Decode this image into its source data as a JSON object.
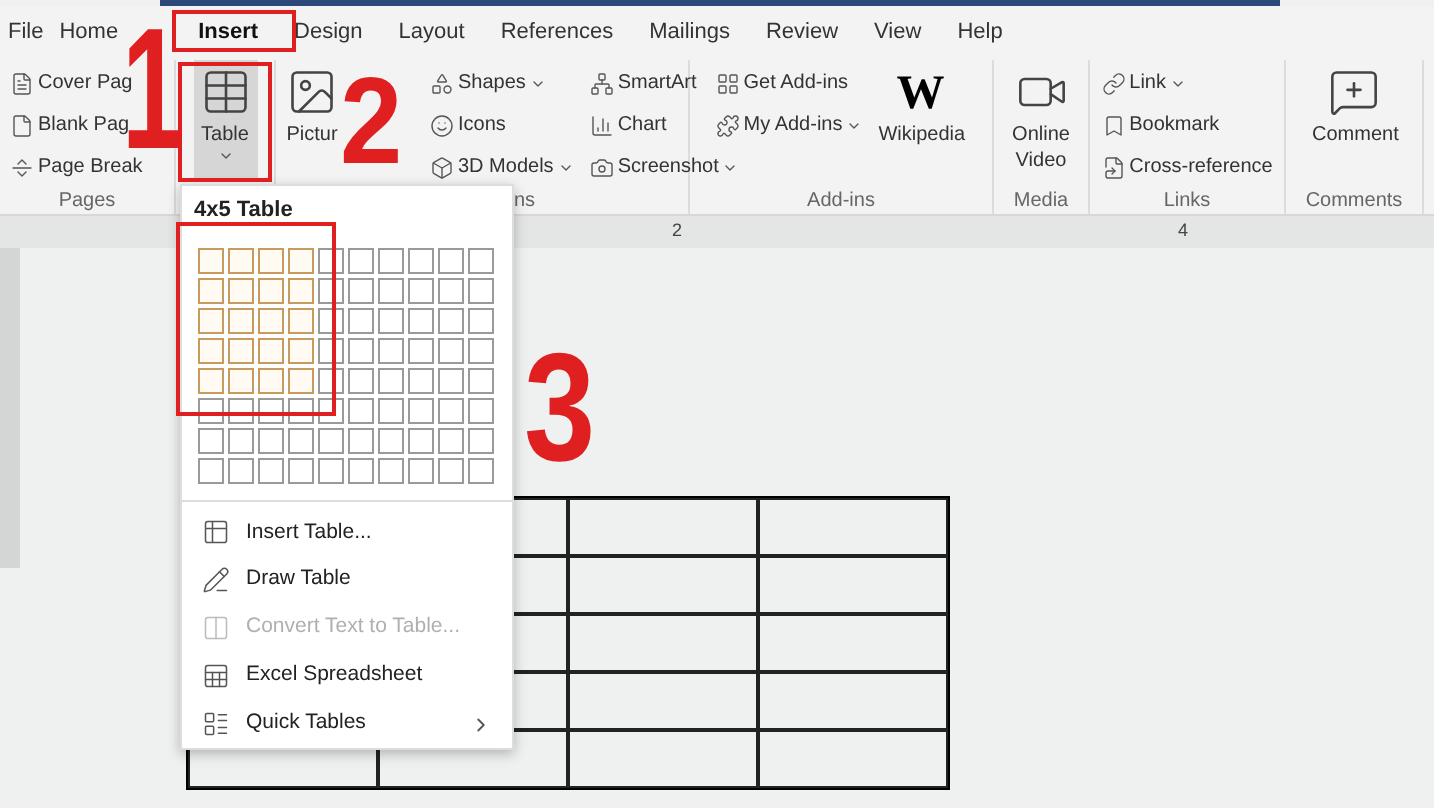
{
  "tabs": [
    {
      "label": "File",
      "selected": false
    },
    {
      "label": "Home",
      "selected": false
    },
    {
      "label": "Insert",
      "selected": true
    },
    {
      "label": "Design",
      "selected": false
    },
    {
      "label": "Layout",
      "selected": false
    },
    {
      "label": "References",
      "selected": false
    },
    {
      "label": "Mailings",
      "selected": false
    },
    {
      "label": "Review",
      "selected": false
    },
    {
      "label": "View",
      "selected": false
    },
    {
      "label": "Help",
      "selected": false
    }
  ],
  "ribbon": [
    {
      "label": "Pages",
      "columns": [
        {
          "kind": "stack",
          "items": [
            {
              "label": "Cover Pag",
              "dropdown": false
            },
            {
              "label": "Blank Pag",
              "dropdown": false
            },
            {
              "label": "Page Break",
              "dropdown": false
            }
          ]
        }
      ]
    },
    {
      "columns": [
        {
          "kind": "large",
          "items": [
            {
              "label": "Table",
              "dropdown": true,
              "pressed": true
            }
          ]
        }
      ]
    },
    {
      "label": "ns",
      "columns": [
        {
          "kind": "large",
          "items": [
            {
              "label": "Pictur",
              "dropdown": false,
              "pressed": false
            }
          ]
        },
        {
          "kind": "stack",
          "items": [
            {
              "label": "Shapes",
              "dropdown": true
            },
            {
              "label": "Icons",
              "dropdown": false
            },
            {
              "label": "3D Models",
              "dropdown": true
            }
          ]
        },
        {
          "kind": "stack",
          "items": [
            {
              "label": "SmartArt",
              "dropdown": false
            },
            {
              "label": "Chart",
              "dropdown": false
            },
            {
              "label": "Screenshot",
              "dropdown": true
            }
          ]
        }
      ]
    },
    {
      "label": "Add-ins",
      "columns": [
        {
          "kind": "stack",
          "items": [
            {
              "label": "Get Add-ins",
              "dropdown": false
            },
            {
              "label": "My Add-ins",
              "dropdown": true
            }
          ]
        },
        {
          "kind": "logo",
          "logo": "W",
          "items": [
            {
              "label": "Wikipedia",
              "dropdown": false,
              "pressed": false
            }
          ]
        }
      ]
    },
    {
      "label": "Media",
      "columns": [
        {
          "kind": "large",
          "items": [
            {
              "label": "Online Video",
              "dropdown": false,
              "pressed": false
            }
          ]
        }
      ]
    },
    {
      "label": "Links",
      "columns": [
        {
          "kind": "stack",
          "items": [
            {
              "label": "Link",
              "dropdown": true
            },
            {
              "label": "Bookmark",
              "dropdown": false
            },
            {
              "label": "Cross-reference",
              "dropdown": false
            }
          ]
        }
      ]
    },
    {
      "label": "Comments",
      "columns": [
        {
          "kind": "large",
          "items": [
            {
              "label": "Comment",
              "dropdown": false,
              "pressed": false
            }
          ]
        }
      ]
    }
  ],
  "ruler": {
    "labels": [
      "2",
      "4"
    ]
  },
  "table_menu": {
    "title": "4x5 Table",
    "grid": [
      [
        true,
        true,
        true,
        true,
        false,
        false,
        false,
        false,
        false,
        false
      ],
      [
        true,
        true,
        true,
        true,
        false,
        false,
        false,
        false,
        false,
        false
      ],
      [
        true,
        true,
        true,
        true,
        false,
        false,
        false,
        false,
        false,
        false
      ],
      [
        true,
        true,
        true,
        true,
        false,
        false,
        false,
        false,
        false,
        false
      ],
      [
        true,
        true,
        true,
        true,
        false,
        false,
        false,
        false,
        false,
        false
      ],
      [
        false,
        false,
        false,
        false,
        false,
        false,
        false,
        false,
        false,
        false
      ],
      [
        false,
        false,
        false,
        false,
        false,
        false,
        false,
        false,
        false,
        false
      ],
      [
        false,
        false,
        false,
        false,
        false,
        false,
        false,
        false,
        false,
        false
      ]
    ],
    "items": [
      {
        "label": "Insert Table...",
        "disabled": false,
        "submenu": false
      },
      {
        "label": "Draw Table",
        "disabled": false,
        "submenu": false
      },
      {
        "label": "Convert Text to Table...",
        "disabled": true,
        "submenu": false
      },
      {
        "label": "Excel Spreadsheet",
        "disabled": false,
        "submenu": false
      },
      {
        "label": "Quick Tables",
        "disabled": false,
        "submenu": true
      }
    ]
  },
  "annotations": [
    {
      "label": "1"
    },
    {
      "label": "2"
    },
    {
      "label": "3"
    }
  ]
}
